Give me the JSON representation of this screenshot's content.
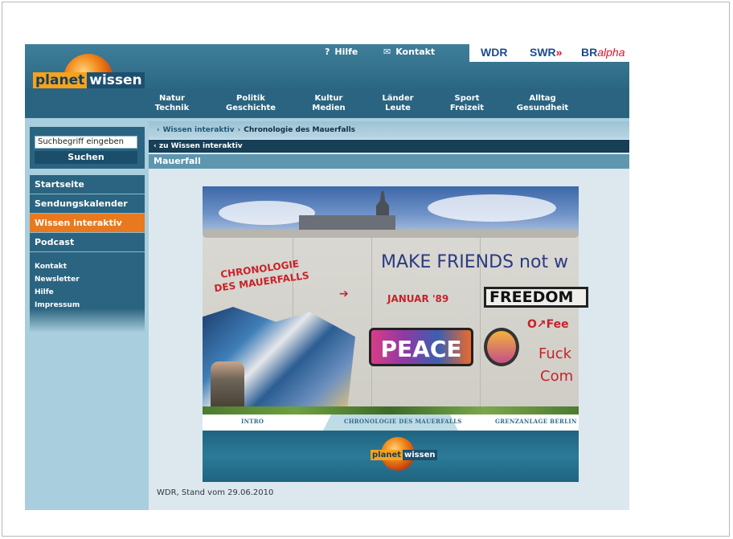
{
  "logo": {
    "part1": "planet",
    "part2": "wissen"
  },
  "utility": {
    "help": {
      "icon": "question-icon",
      "label": "Hilfe"
    },
    "contact": {
      "icon": "envelope-icon",
      "label": "Kontakt"
    }
  },
  "partners": [
    {
      "label": "WDR",
      "color": "#1d4c8c"
    },
    {
      "label": "SWR",
      "suffix": "»",
      "color": "#1d4c8c",
      "accent": "#e0102a"
    },
    {
      "label": "BR",
      "label2": "alpha",
      "color": "#1d4c8c",
      "accent": "#e0102a"
    }
  ],
  "nav": [
    {
      "line1": "Natur",
      "line2": "Technik"
    },
    {
      "line1": "Politik",
      "line2": "Geschichte"
    },
    {
      "line1": "Kultur",
      "line2": "Medien"
    },
    {
      "line1": "Länder",
      "line2": "Leute"
    },
    {
      "line1": "Sport",
      "line2": "Freizeit"
    },
    {
      "line1": "Alltag",
      "line2": "Gesundheit"
    }
  ],
  "search": {
    "value": "Suchbegriff eingeben",
    "button": "Suchen"
  },
  "menu": [
    {
      "label": "Startseite"
    },
    {
      "label": "Sendungskalender"
    },
    {
      "label": "Wissen interaktiv",
      "active": true
    },
    {
      "label": "Podcast"
    }
  ],
  "submenu": [
    {
      "label": "Kontakt"
    },
    {
      "label": "Newsletter"
    },
    {
      "label": "Hilfe"
    },
    {
      "label": "Impressum"
    }
  ],
  "breadcrumb": {
    "parent": "Wissen interaktiv",
    "current": "Chronologie des Mauerfalls"
  },
  "back_link": "zu Wissen interaktiv",
  "title": "Mauerfall",
  "flash": {
    "graffiti": {
      "chronologie_line1": "CHRONOLOGIE",
      "chronologie_line2": "DES MAUERFALLS",
      "date": "JANUAR '89",
      "make_friends": "MAKE FRIENDS not w",
      "freedom": "FREEDOM",
      "peace": "PEACE",
      "fuck": "Fuck",
      "com": "Com",
      "fee": "O↗Fee"
    },
    "tabs": [
      {
        "label": "INTRO"
      },
      {
        "label": "CHRONOLOGIE DES MAUERFALLS",
        "active": true
      },
      {
        "label": "GRENZANLAGE BERLIN"
      }
    ],
    "logo": {
      "part1": "planet",
      "part2": "wissen"
    }
  },
  "footer": {
    "stand": "WDR, Stand vom 29.06.2010"
  }
}
